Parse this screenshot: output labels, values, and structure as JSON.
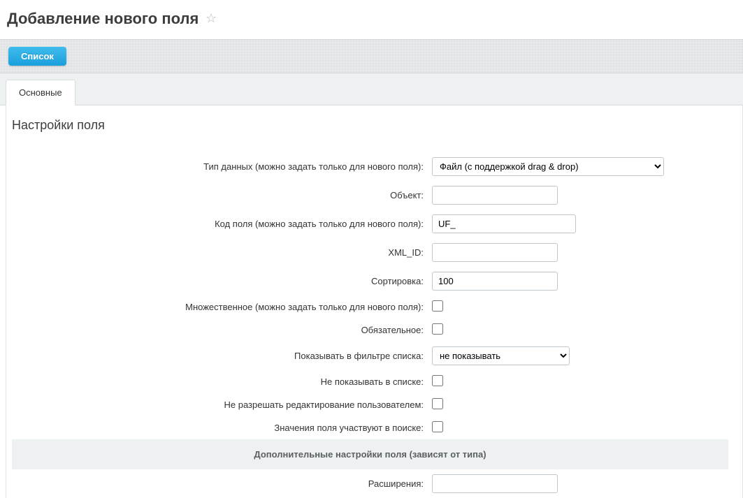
{
  "page": {
    "title": "Добавление нового поля"
  },
  "toolbar": {
    "list_button": "Список"
  },
  "tabs": {
    "main": "Основные"
  },
  "section": {
    "title": "Настройки поля"
  },
  "labels": {
    "data_type": "Тип данных (можно задать только для нового поля):",
    "object": "Объект:",
    "field_code": "Код поля (можно задать только для нового поля):",
    "xml_id": "XML_ID:",
    "sort": "Сортировка:",
    "multiple": "Множественное (можно задать только для нового поля):",
    "required": "Обязательное:",
    "show_filter": "Показывать в фильтре списка:",
    "hide_in_list": "Не показывать в списке:",
    "no_user_edit": "Не разрешать редактирование пользователем:",
    "searchable": "Значения поля участвуют в поиске:",
    "additional_header": "Дополнительные настройки поля (зависят от типа)",
    "extensions": "Расширения:"
  },
  "values": {
    "data_type_selected": "Файл (с поддержкой drag & drop)",
    "object": "",
    "field_code": "UF_",
    "xml_id": "",
    "sort": "100",
    "show_filter_selected": "не показывать",
    "extensions": ""
  }
}
